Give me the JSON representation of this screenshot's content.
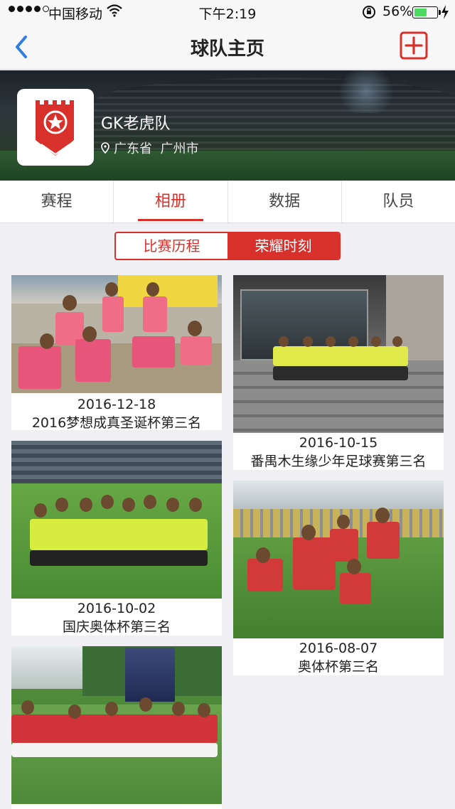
{
  "status_bar": {
    "carrier": "中国移动",
    "time": "下午2:19",
    "battery_percent": "56%",
    "battery_level": 0.56,
    "icons": [
      "signal-dots",
      "wifi-icon",
      "orientation-lock-icon",
      "battery-icon",
      "charging-bolt-icon"
    ]
  },
  "nav": {
    "title": "球队主页",
    "back_icon": "chevron-left-icon",
    "add_icon": "plus-square-icon",
    "accent": "#d8312c",
    "back_color": "#2f7de1"
  },
  "team": {
    "name": "GK老虎队",
    "location": "广东省  广州市",
    "logo_icon": "red-shield-star-logo"
  },
  "tabs": [
    {
      "label": "赛程",
      "active": false
    },
    {
      "label": "相册",
      "active": true
    },
    {
      "label": "数据",
      "active": false
    },
    {
      "label": "队员",
      "active": false
    }
  ],
  "segments": [
    {
      "label": "比赛历程",
      "active": false
    },
    {
      "label": "荣耀时刻",
      "active": true
    }
  ],
  "albums": [
    {
      "date": "2016-12-18",
      "title": "2016梦想成真圣诞杯第三名"
    },
    {
      "date": "2016-10-15",
      "title": "番禺木生缘少年足球赛第三名"
    },
    {
      "date": "2016-10-02",
      "title": "国庆奥体杯第三名"
    },
    {
      "date": "2016-08-07",
      "title": "奥体杯第三名"
    },
    {
      "date": "",
      "title": ""
    }
  ]
}
